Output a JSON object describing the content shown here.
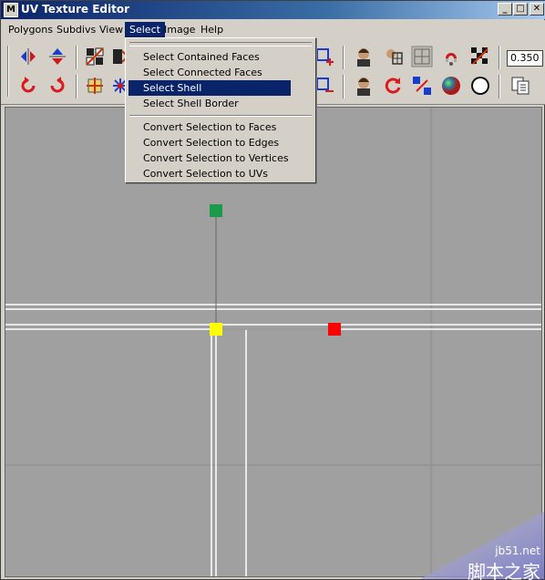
{
  "window": {
    "title": "UV Texture Editor",
    "controls": {
      "minimize": "_",
      "maximize": "□",
      "close": "✕"
    }
  },
  "menubar": {
    "items": [
      {
        "label": "Polygons"
      },
      {
        "label": "Subdivs"
      },
      {
        "label": "View"
      },
      {
        "label": "Select"
      },
      {
        "label": "Image"
      },
      {
        "label": "Help"
      }
    ]
  },
  "toolbar": {
    "zoom_value": "0.350"
  },
  "select_menu": {
    "group1": [
      {
        "label": "Select Contained Faces"
      },
      {
        "label": "Select Connected Faces"
      },
      {
        "label": "Select Shell"
      },
      {
        "label": "Select Shell Border"
      }
    ],
    "group2": [
      {
        "label": "Convert Selection to Faces"
      },
      {
        "label": "Convert Selection to Edges"
      },
      {
        "label": "Convert Selection to Vertices"
      },
      {
        "label": "Convert Selection to UVs"
      }
    ],
    "highlighted": "Select Shell"
  },
  "viewport": {
    "colors": {
      "background": "#a0a0a0",
      "grid": "#8c8c8c",
      "uv_line": "#ffffff",
      "green": "#1a9a4a",
      "yellow": "#ffff00",
      "red": "#ff0000"
    }
  },
  "watermark": {
    "site": "jb51.net",
    "name": "脚本之家"
  }
}
